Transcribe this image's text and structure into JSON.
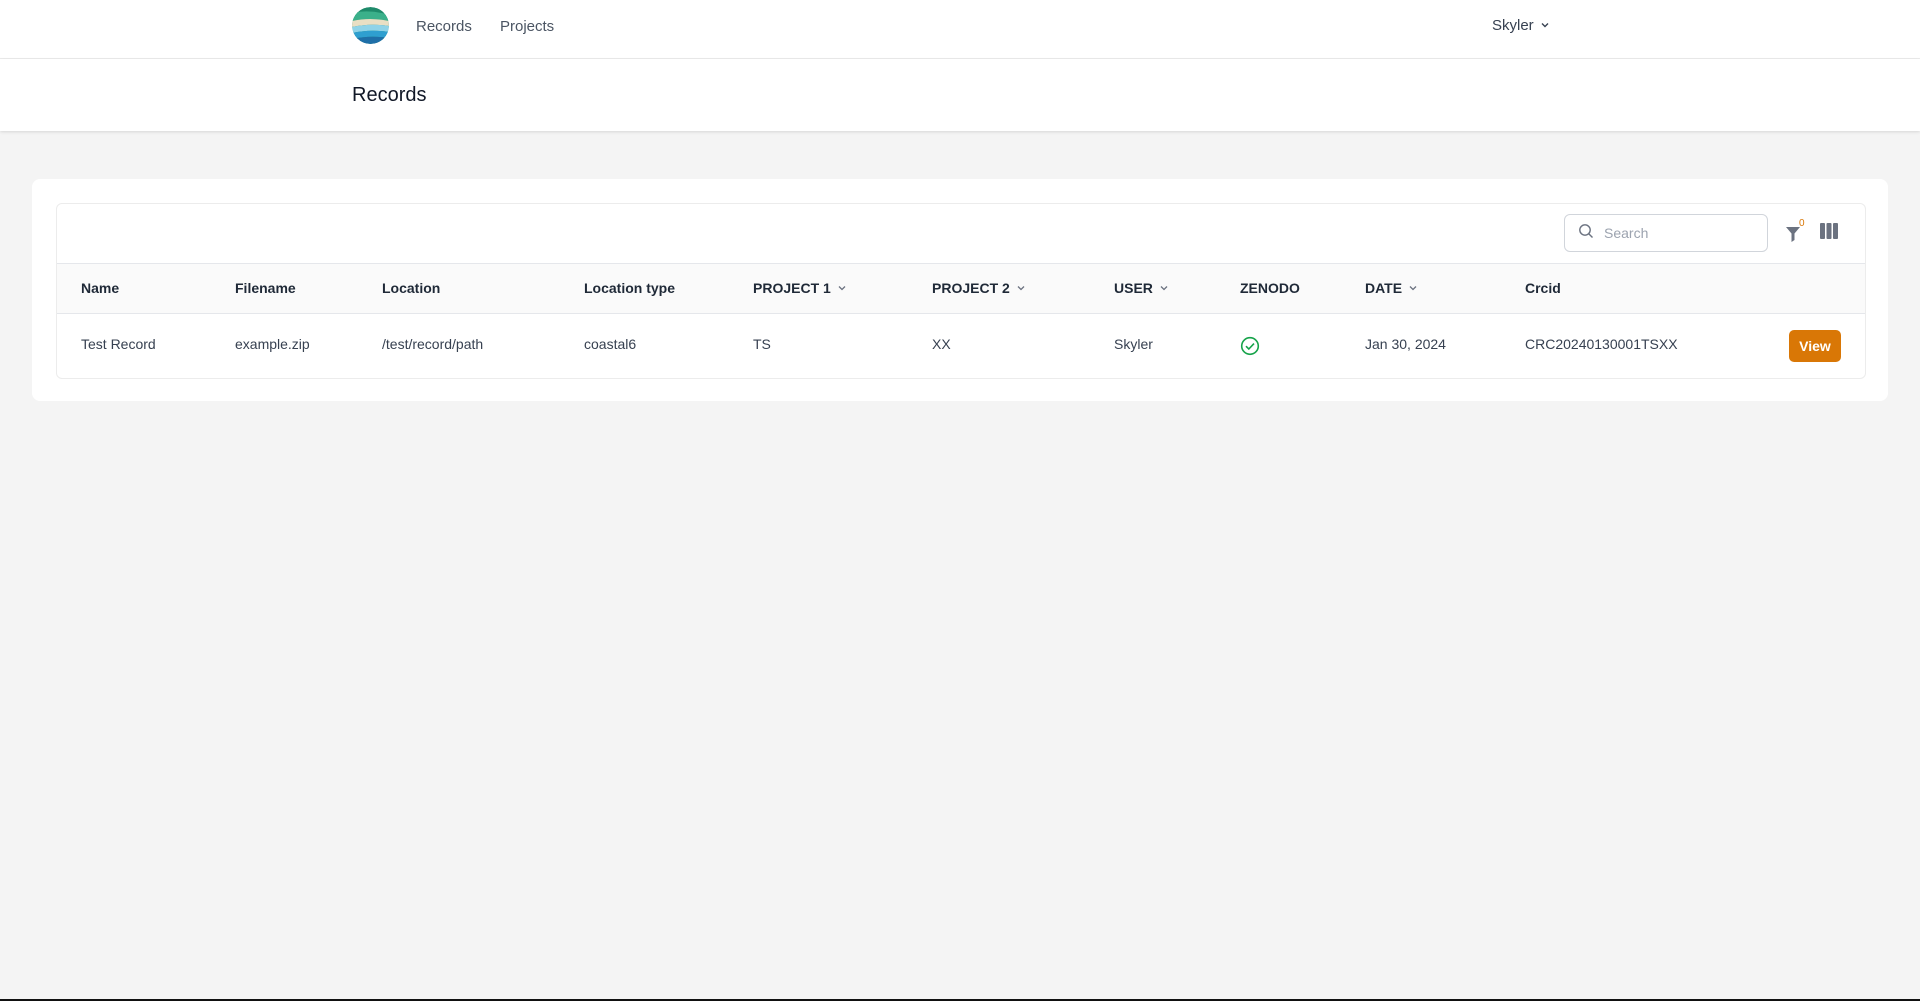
{
  "nav": {
    "logo_icon": "ocean-globe-logo",
    "links": [
      {
        "label": "Records"
      },
      {
        "label": "Projects"
      }
    ],
    "user": {
      "name": "Skyler",
      "icon": "chevron-down-icon"
    }
  },
  "page": {
    "title": "Records"
  },
  "toolbar": {
    "search_placeholder": "Search",
    "filter_count": "0",
    "icons": [
      "search-icon",
      "filter-icon",
      "columns-icon"
    ]
  },
  "table": {
    "columns": [
      {
        "label": "Name",
        "sortable": false
      },
      {
        "label": "Filename",
        "sortable": false
      },
      {
        "label": "Location",
        "sortable": false
      },
      {
        "label": "Location type",
        "sortable": false
      },
      {
        "label": "PROJECT 1",
        "sortable": true
      },
      {
        "label": "PROJECT 2",
        "sortable": true
      },
      {
        "label": "USER",
        "sortable": true
      },
      {
        "label": "ZENODO",
        "sortable": false
      },
      {
        "label": "DATE",
        "sortable": true
      },
      {
        "label": "Crcid",
        "sortable": false
      }
    ],
    "rows": [
      {
        "name": "Test Record",
        "filename": "example.zip",
        "location": "/test/record/path",
        "location_type": "coastal6",
        "project1": "TS",
        "project2": "XX",
        "user": "Skyler",
        "zenodo": "check-circle-icon",
        "date": "Jan 30, 2024",
        "crcid": "CRC20240130001TSXX",
        "action_label": "View"
      }
    ]
  },
  "colors": {
    "accent": "#d97706",
    "success": "#16a34a",
    "background": "#f4f4f4"
  }
}
